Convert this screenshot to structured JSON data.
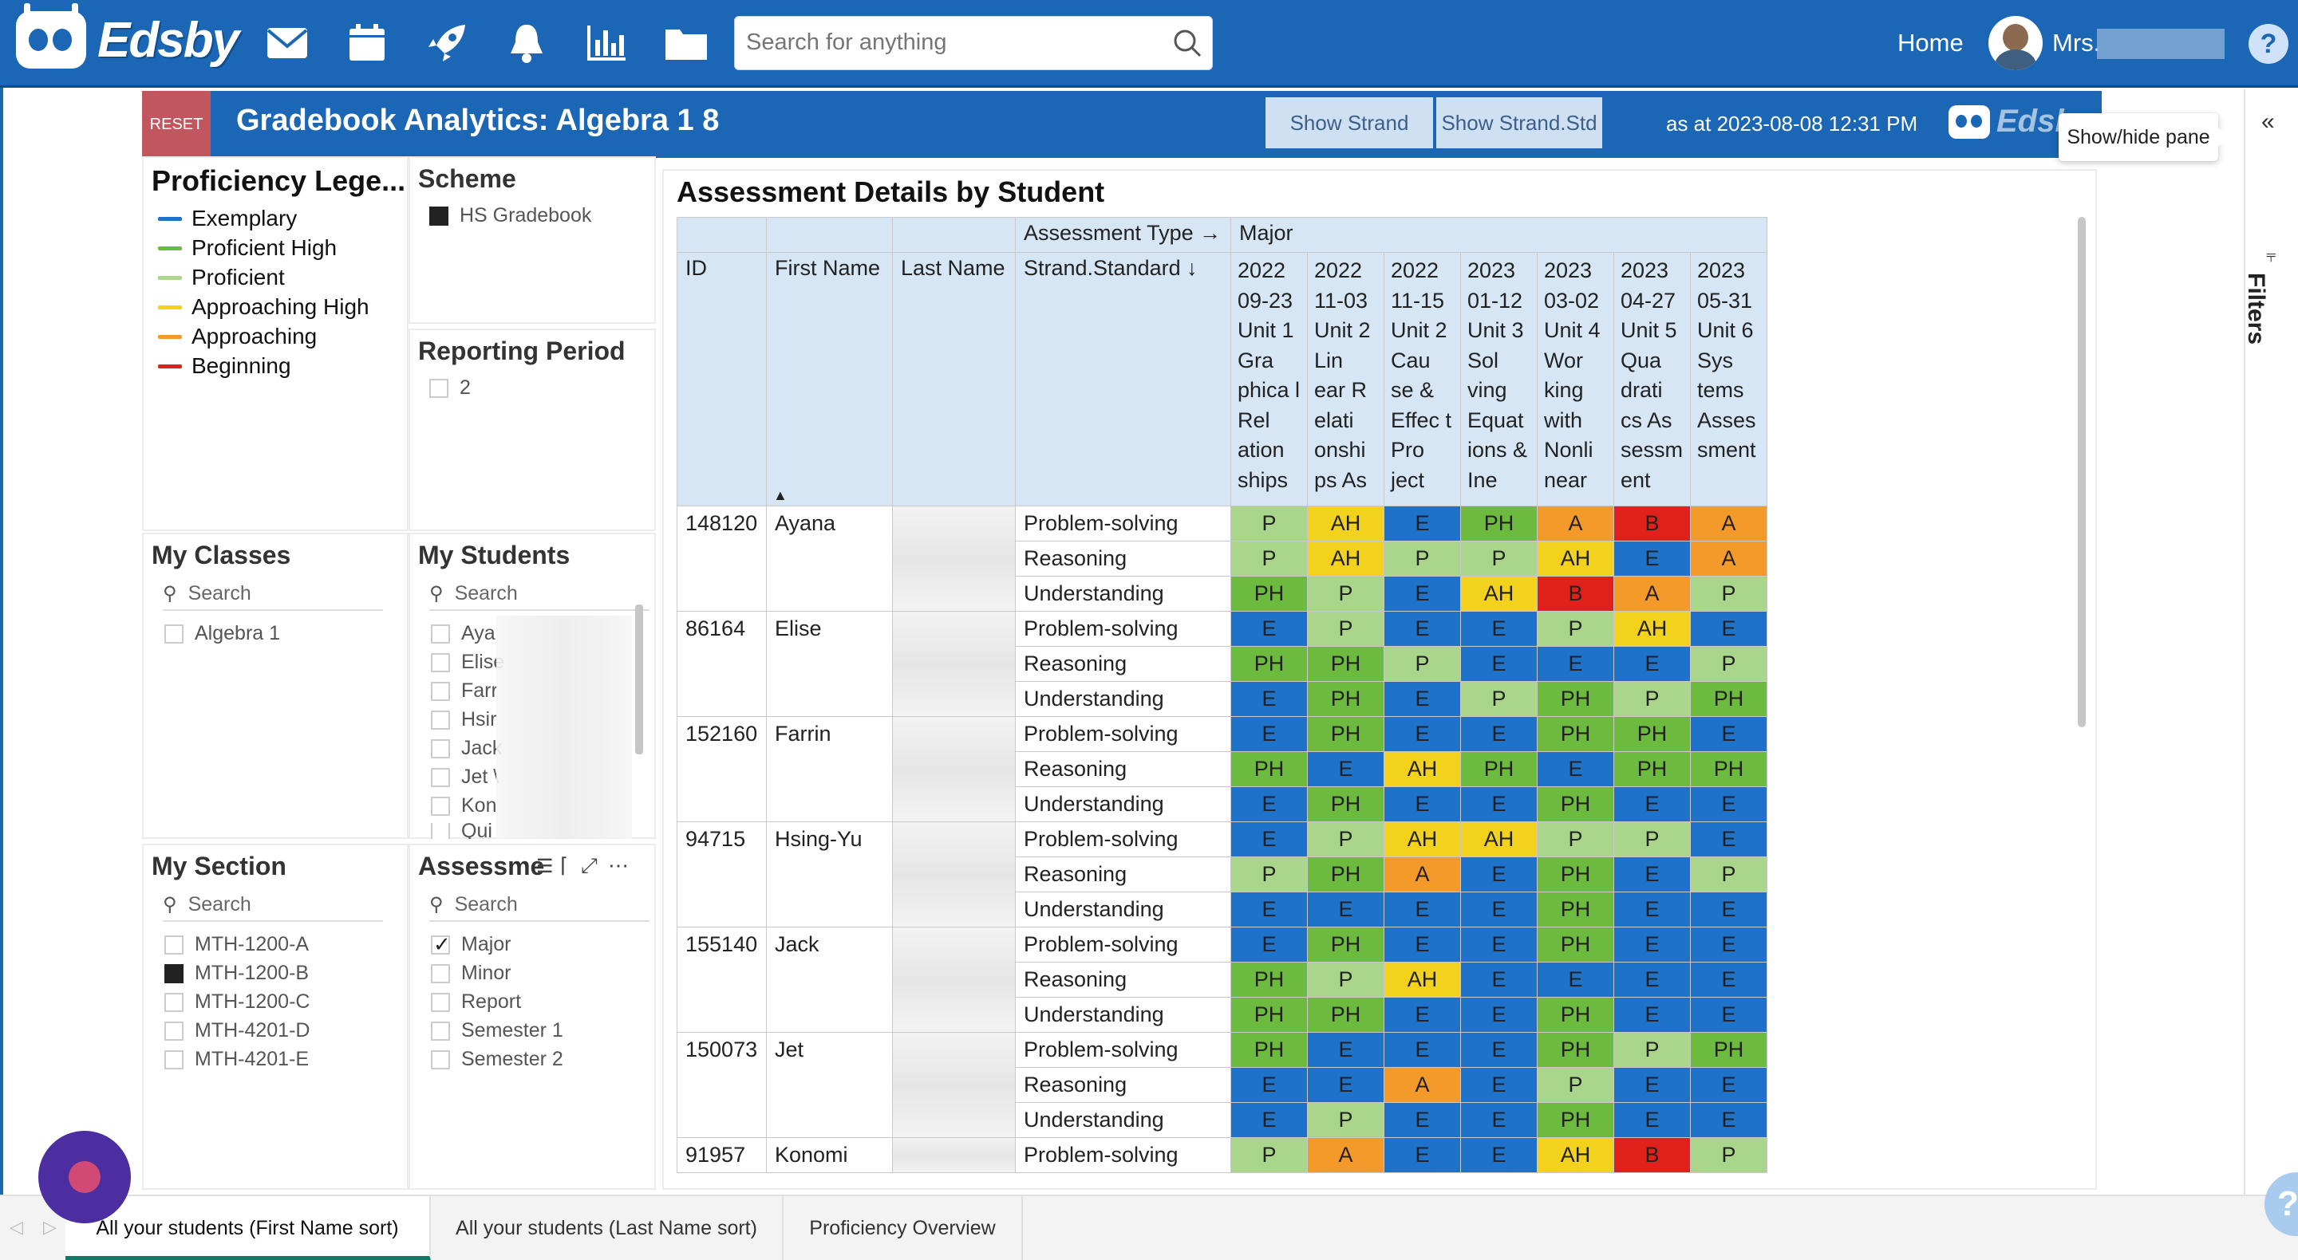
{
  "app": {
    "logo_text": "Edsby",
    "search_placeholder": "Search for anything",
    "home": "Home",
    "user": "Mrs.",
    "help": "?"
  },
  "nav_icons": [
    "mail-icon",
    "calendar-icon",
    "rocket-icon",
    "bell-icon",
    "chart-icon",
    "folder-icon"
  ],
  "report": {
    "reset": "RESET",
    "title": "Gradebook Analytics: Algebra 1 8",
    "btn_strand": "Show Strand",
    "btn_strand_std": "Show Strand.Std",
    "as_at": "as at 2023-08-08 12:31 PM",
    "logo_text": "Edsb"
  },
  "tooltip": "Show/hide pane",
  "filters_label": "Filters",
  "legend": {
    "title": "Proficiency Lege...",
    "items": [
      {
        "label": "Exemplary",
        "color": "#1e72c9"
      },
      {
        "label": "Proficient High",
        "color": "#6dbb3e"
      },
      {
        "label": "Proficient",
        "color": "#a9d68a"
      },
      {
        "label": "Approaching High",
        "color": "#f2d21c"
      },
      {
        "label": "Approaching",
        "color": "#f39a2a"
      },
      {
        "label": "Beginning",
        "color": "#e0201a"
      }
    ]
  },
  "scheme": {
    "title": "Scheme",
    "item": "HS Gradebook"
  },
  "period": {
    "title": "Reporting Period",
    "item": "2"
  },
  "classes": {
    "title": "My Classes",
    "search": "Search",
    "items": [
      "Algebra 1"
    ]
  },
  "students": {
    "title": "My Students",
    "search": "Search",
    "items": [
      "Aya",
      "Elise",
      "Farr",
      "Hsir",
      "Jack",
      "Jet \\",
      "Kon",
      "Qui"
    ]
  },
  "section": {
    "title": "My Section",
    "search": "Search",
    "items": [
      "MTH-1200-A",
      "MTH-1200-B",
      "MTH-1200-C",
      "MTH-4201-D",
      "MTH-4201-E"
    ]
  },
  "assess": {
    "title": "Assessme",
    "search": "Search",
    "items": [
      "Major",
      "Minor",
      "Report",
      "Semester 1",
      "Semester 2"
    ]
  },
  "grid": {
    "title": "Assessment Details by Student",
    "assessment_type_label": "Assessment Type →",
    "assessment_type": "Major",
    "headers": {
      "id": "ID",
      "first": "First Name",
      "last": "Last Name",
      "strand": "Strand.Standard ↓"
    },
    "columns": [
      "2022 09-23 Unit 1 Gra phica l Rel ation ships",
      "2022 11-03 Unit 2 Lin ear R elati onshi ps As",
      "2022 11-15 Unit 2 Cau se & Effec t Pro ject",
      "2023 01-12 Unit 3 Sol ving Equat ions & Ine",
      "2023 03-02 Unit 4 Wor king with Nonli near",
      "2023 04-27 Unit 5 Qua drati cs As sessm ent",
      "2023 05-31 Unit 6 Sys tems Asses sment"
    ],
    "students": [
      {
        "id": "148120",
        "first": "Ayana",
        "rows": [
          {
            "strand": "Problem-solving",
            "grades": [
              "P",
              "AH",
              "E",
              "PH",
              "A",
              "B",
              "A"
            ]
          },
          {
            "strand": "Reasoning",
            "grades": [
              "P",
              "AH",
              "P",
              "P",
              "AH",
              "E",
              "A"
            ]
          },
          {
            "strand": "Understanding",
            "grades": [
              "PH",
              "P",
              "E",
              "AH",
              "B",
              "A",
              "P"
            ]
          }
        ]
      },
      {
        "id": "86164",
        "first": "Elise",
        "rows": [
          {
            "strand": "Problem-solving",
            "grades": [
              "E",
              "P",
              "E",
              "E",
              "P",
              "AH",
              "E"
            ]
          },
          {
            "strand": "Reasoning",
            "grades": [
              "PH",
              "PH",
              "P",
              "E",
              "E",
              "E",
              "P"
            ]
          },
          {
            "strand": "Understanding",
            "grades": [
              "E",
              "PH",
              "E",
              "P",
              "PH",
              "P",
              "PH"
            ]
          }
        ]
      },
      {
        "id": "152160",
        "first": "Farrin",
        "rows": [
          {
            "strand": "Problem-solving",
            "grades": [
              "E",
              "PH",
              "E",
              "E",
              "PH",
              "PH",
              "E"
            ]
          },
          {
            "strand": "Reasoning",
            "grades": [
              "PH",
              "E",
              "AH",
              "PH",
              "E",
              "PH",
              "PH"
            ]
          },
          {
            "strand": "Understanding",
            "grades": [
              "E",
              "PH",
              "E",
              "E",
              "PH",
              "E",
              "E"
            ]
          }
        ]
      },
      {
        "id": "94715",
        "first": "Hsing-Yu",
        "rows": [
          {
            "strand": "Problem-solving",
            "grades": [
              "E",
              "P",
              "AH",
              "AH",
              "P",
              "P",
              "E"
            ]
          },
          {
            "strand": "Reasoning",
            "grades": [
              "P",
              "PH",
              "A",
              "E",
              "PH",
              "E",
              "P"
            ]
          },
          {
            "strand": "Understanding",
            "grades": [
              "E",
              "E",
              "E",
              "E",
              "PH",
              "E",
              "E"
            ]
          }
        ]
      },
      {
        "id": "155140",
        "first": "Jack",
        "rows": [
          {
            "strand": "Problem-solving",
            "grades": [
              "E",
              "PH",
              "E",
              "E",
              "PH",
              "E",
              "E"
            ]
          },
          {
            "strand": "Reasoning",
            "grades": [
              "PH",
              "P",
              "AH",
              "E",
              "E",
              "E",
              "E"
            ]
          },
          {
            "strand": "Understanding",
            "grades": [
              "PH",
              "PH",
              "E",
              "E",
              "PH",
              "E",
              "E"
            ]
          }
        ]
      },
      {
        "id": "150073",
        "first": "Jet",
        "rows": [
          {
            "strand": "Problem-solving",
            "grades": [
              "PH",
              "E",
              "E",
              "E",
              "PH",
              "P",
              "PH"
            ]
          },
          {
            "strand": "Reasoning",
            "grades": [
              "E",
              "E",
              "A",
              "E",
              "P",
              "E",
              "E"
            ]
          },
          {
            "strand": "Understanding",
            "grades": [
              "E",
              "P",
              "E",
              "E",
              "PH",
              "E",
              "E"
            ]
          }
        ]
      },
      {
        "id": "91957",
        "first": "Konomi",
        "rows": [
          {
            "strand": "Problem-solving",
            "grades": [
              "P",
              "A",
              "E",
              "E",
              "AH",
              "B",
              "P"
            ]
          }
        ]
      }
    ]
  },
  "tabs": [
    "All your students (First Name sort)",
    "All your students (Last Name sort)",
    "Proficiency Overview"
  ]
}
